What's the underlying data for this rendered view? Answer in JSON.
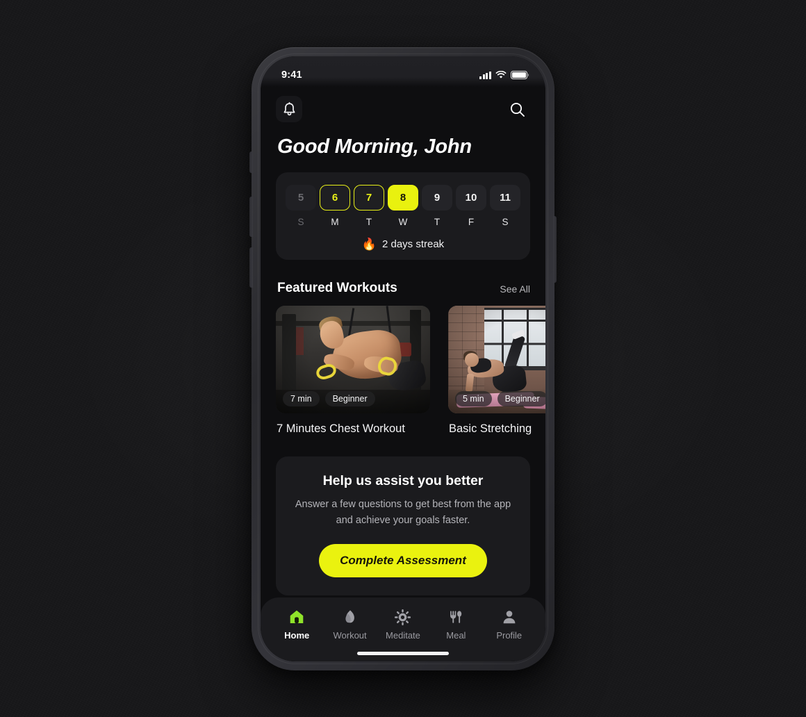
{
  "status_bar": {
    "time": "9:41",
    "signal_icon": "cellular-bars-icon",
    "wifi_icon": "wifi-icon",
    "battery_icon": "battery-full-icon"
  },
  "header": {
    "notification_icon": "bell-icon",
    "search_icon": "search-icon",
    "greeting": "Good Morning, John"
  },
  "calendar": {
    "days": [
      {
        "num": "5",
        "dow": "S",
        "state": "past-inactive"
      },
      {
        "num": "6",
        "dow": "M",
        "state": "completed"
      },
      {
        "num": "7",
        "dow": "T",
        "state": "completed"
      },
      {
        "num": "8",
        "dow": "W",
        "state": "today"
      },
      {
        "num": "9",
        "dow": "T",
        "state": "upcoming"
      },
      {
        "num": "10",
        "dow": "F",
        "state": "upcoming"
      },
      {
        "num": "11",
        "dow": "S",
        "state": "upcoming"
      }
    ],
    "streak_icon": "flame-emoji",
    "streak_glyph": "🔥",
    "streak_text": "2 days streak"
  },
  "featured": {
    "section_title": "Featured Workouts",
    "see_all_label": "See All",
    "cards": [
      {
        "title": "7 Minutes Chest Workout",
        "duration_tag": "7 min",
        "level_tag": "Beginner",
        "image_desc": "man-doing-cable-chest-press-in-gym"
      },
      {
        "title": "Basic Stretching",
        "duration_tag": "5 min",
        "level_tag": "Beginner",
        "image_desc": "two-women-stretching-on-pink-yoga-mats"
      }
    ]
  },
  "assessment": {
    "title": "Help us assist you better",
    "subtitle": "Answer a few questions to get best from the app and achieve your goals faster.",
    "button_label": "Complete Assessment"
  },
  "tabbar": {
    "tabs": [
      {
        "label": "Home",
        "icon": "home-icon",
        "active": true
      },
      {
        "label": "Workout",
        "icon": "flame-icon",
        "active": false
      },
      {
        "label": "Meditate",
        "icon": "lotus-gear-icon",
        "active": false
      },
      {
        "label": "Meal",
        "icon": "cutlery-icon",
        "active": false
      },
      {
        "label": "Profile",
        "icon": "person-icon",
        "active": false
      }
    ]
  },
  "colors": {
    "accent_yellow": "#eaf20f",
    "accent_green": "#8fe32a",
    "screen_bg": "#0e0e10",
    "card_bg": "#1b1b1e",
    "page_bg": "#171719",
    "text_primary": "#ffffff",
    "text_muted": "#b4b4b9"
  }
}
